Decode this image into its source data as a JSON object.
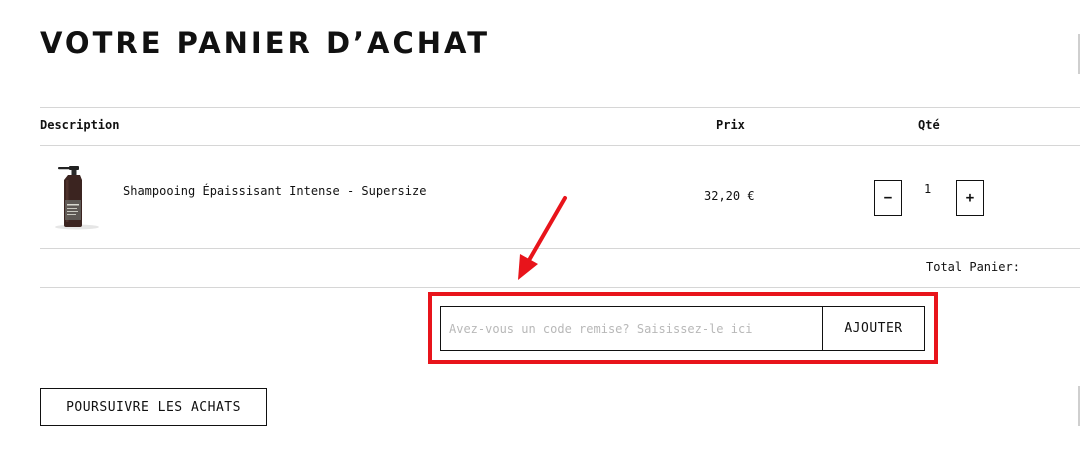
{
  "cart": {
    "title": "VOTRE PANIER D’ACHAT",
    "headers": {
      "description": "Description",
      "price": "Prix",
      "qty": "Qté"
    },
    "items": [
      {
        "name": "Shampooing Épaissisant Intense - Supersize",
        "price": "32,20 €",
        "quantity": "1",
        "decrement_label": "−",
        "increment_label": "+",
        "image_icon": "shampoo-bottle"
      }
    ],
    "total_label": "Total Panier:"
  },
  "coupon": {
    "placeholder": "Avez-vous un code remise? Saisissez-le ici",
    "value": "",
    "button_label": "AJOUTER"
  },
  "actions": {
    "continue_label": "POURSUIVRE LES ACHATS"
  },
  "colors": {
    "annotation_red": "#e8141b",
    "text": "#111111",
    "divider": "#d6d6d6"
  }
}
